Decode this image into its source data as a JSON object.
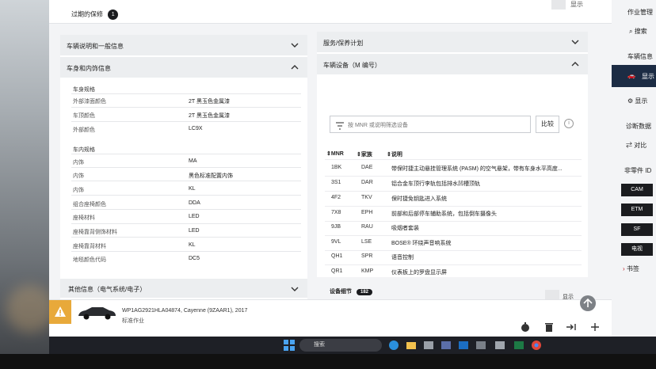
{
  "header": {
    "expired_label": "过期的保修",
    "expired_count": "1",
    "show_label": "显示"
  },
  "left": {
    "acc1_title": "车辆说明和一般信息",
    "acc2_title": "车身和内饰信息",
    "body_section": "车身规格",
    "body_rows": [
      {
        "label": "外部漆面颜色",
        "value": "2T 黑玉色金属漆"
      },
      {
        "label": "车顶颜色",
        "value": "2T 黑玉色金属漆"
      },
      {
        "label": "外部颜色",
        "value": "LC9X"
      }
    ],
    "interior_section": "车内规格",
    "interior_rows": [
      {
        "label": "内饰",
        "value": "MA"
      },
      {
        "label": "内饰",
        "value": "黑色标准配置内饰"
      },
      {
        "label": "内饰",
        "value": "KL"
      },
      {
        "label": "组合座椅颜色",
        "value": "DDA"
      },
      {
        "label": "座椅材料",
        "value": "LED"
      },
      {
        "label": "座椅靠背侧饰材料",
        "value": "LED"
      },
      {
        "label": "座椅靠背材料",
        "value": "KL"
      },
      {
        "label": "地毯颜色代码",
        "value": "DC5"
      }
    ],
    "acc3_title": "其他信息（电气系统/电子）"
  },
  "right": {
    "acc1_title": "服务/保养计划",
    "acc2_title": "车辆设备（M 编号）",
    "filter_placeholder": "按 MNR 或说明筛选设备",
    "compare_label": "比较",
    "columns": [
      "MNR",
      "家族",
      "说明"
    ],
    "rows": [
      {
        "mnr": "1BK",
        "family": "DAE",
        "desc": "带保时捷主动悬挂管理系统 (PASM) 的空气悬架，带有车身水平高度..."
      },
      {
        "mnr": "3S1",
        "family": "DAR",
        "desc": "铝合金车顶行李轨包括排水凹槽顶轨"
      },
      {
        "mnr": "4F2",
        "family": "TKV",
        "desc": "保时捷免钥匙进入系统"
      },
      {
        "mnr": "7X8",
        "family": "EPH",
        "desc": "前部和后部停车辅助系统，包括倒车摄像头"
      },
      {
        "mnr": "9JB",
        "family": "RAU",
        "desc": "吸烟者套装"
      },
      {
        "mnr": "9VL",
        "family": "LSE",
        "desc": "BOSE® 环绕声音响系统"
      },
      {
        "mnr": "QH1",
        "family": "SPR",
        "desc": "语音控制"
      },
      {
        "mnr": "QR1",
        "family": "KMP",
        "desc": "仪表板上的罗盘显示屏"
      }
    ],
    "detail_label": "设备细节",
    "detail_count": "182",
    "show_label": "显示"
  },
  "footer": {
    "vin_model": "WP1AG2921HLA04874, Cayenne (9ZAAR1), 2017",
    "task": "标准作业"
  },
  "sidebar": {
    "work_manage": "作业管理",
    "search": "搜索",
    "vehicle_info": "车辆信息",
    "show1": "显示",
    "show2": "显示",
    "diagnostic": "诊断数据",
    "compare": "对比",
    "non_part": "非零件 ID",
    "btns": [
      "CAM",
      "ETM",
      "SF",
      "电视"
    ],
    "bookmark": "书签"
  },
  "taskbar": {
    "search": "搜索"
  }
}
